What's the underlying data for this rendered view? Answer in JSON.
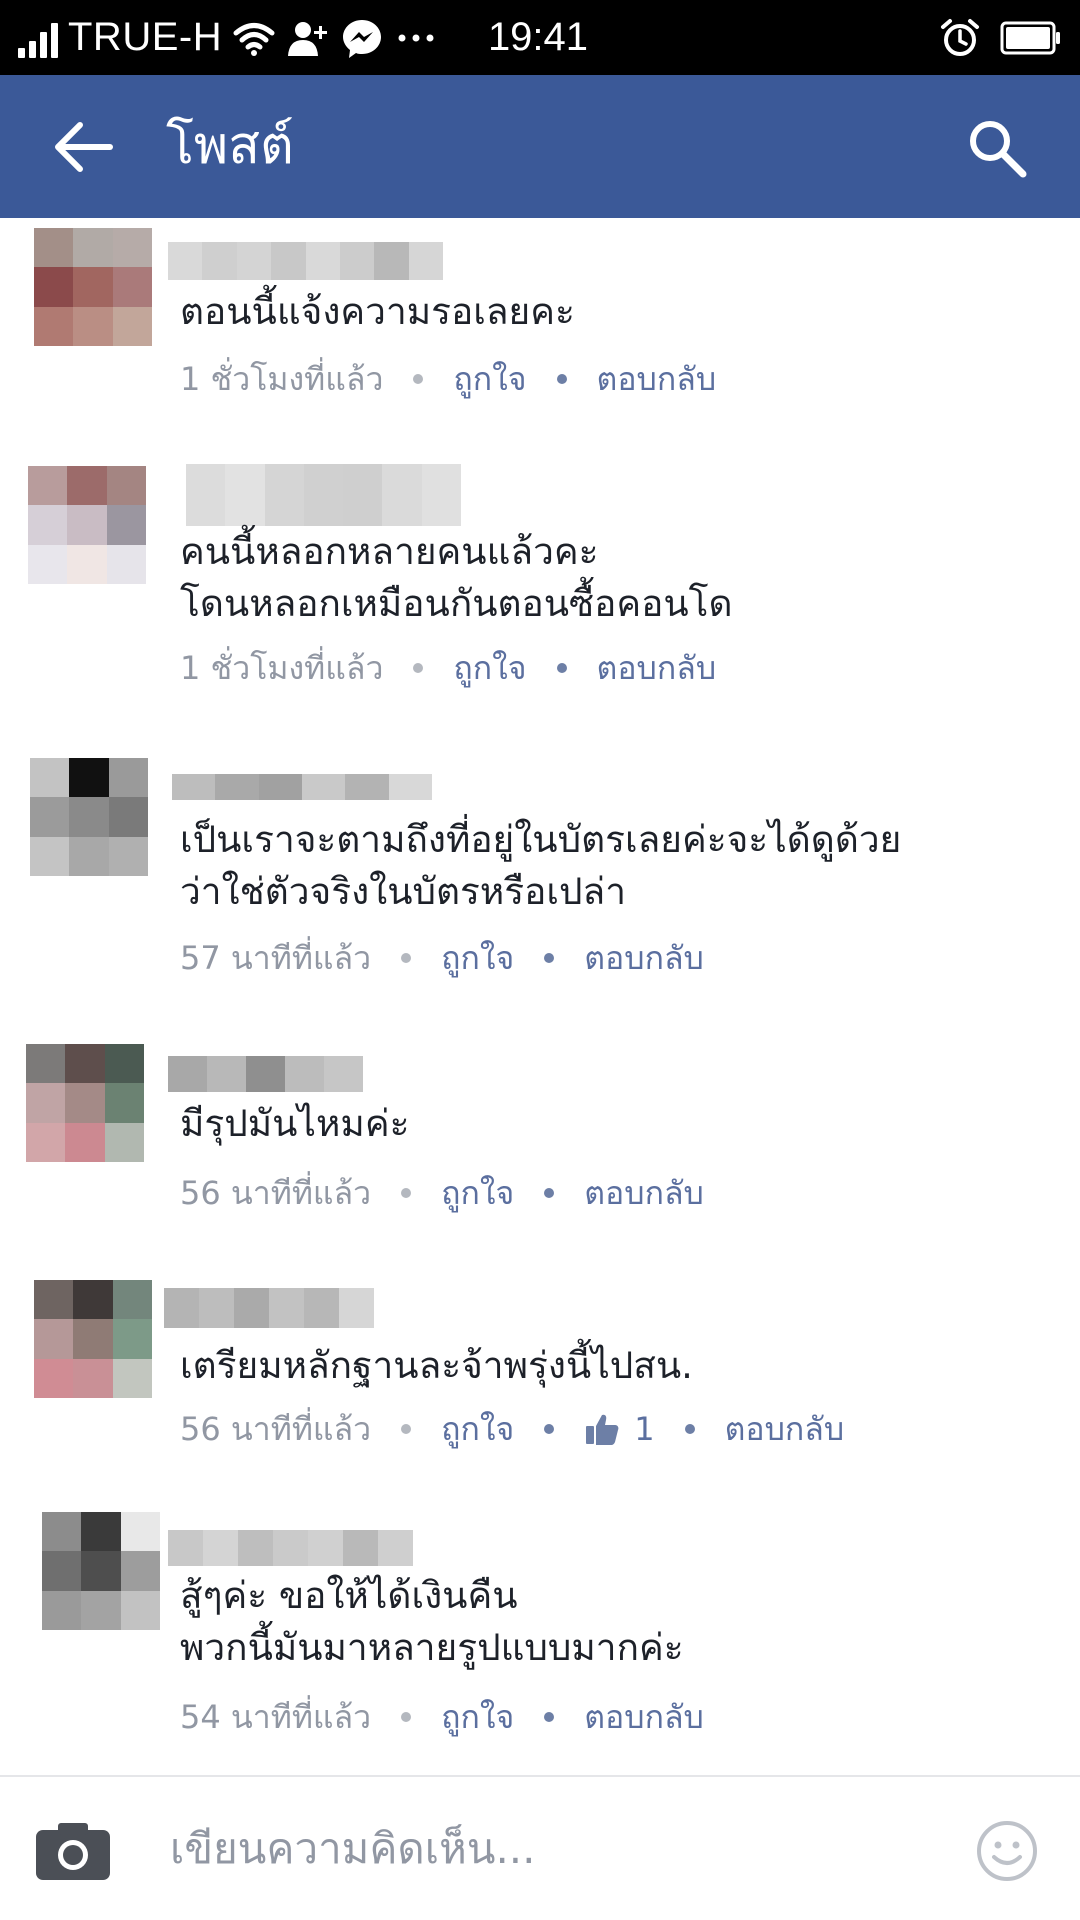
{
  "status_bar": {
    "carrier": "TRUE-H",
    "time": "19:41",
    "icons": [
      "signal-icon",
      "wifi-icon",
      "friend-request-icon",
      "messenger-icon",
      "more-icon",
      "alarm-icon",
      "battery-icon"
    ]
  },
  "app_bar": {
    "title": "โพสต์",
    "back_icon": "arrow-left-icon",
    "search_icon": "search-icon"
  },
  "comments": [
    {
      "text": "ตอนนี้แจ้งความรอเลยคะ",
      "time": "1 ชั่วโมงที่แล้ว",
      "like_label": "ถูกใจ",
      "reply_label": "ตอบกลับ",
      "avatar_colors": [
        "#a38f88",
        "#b1aaa6",
        "#b6aba8",
        "#8b4a4b",
        "#a16660",
        "#aa7a7a",
        "#b07a72",
        "#ba8e84",
        "#c2a69a"
      ],
      "name_colors": [
        "#d9d9d9",
        "#cfcfcf",
        "#d4d4d4",
        "#c8c8c8",
        "#d9d9d9",
        "#cccccc",
        "#b8b8b8",
        "#d6d6d6"
      ]
    },
    {
      "text": "คนนี้หลอกหลายคนแล้วคะ\nโดนหลอกเหมือนกันตอนซื้อคอนโด",
      "time": "1 ชั่วโมงที่แล้ว",
      "like_label": "ถูกใจ",
      "reply_label": "ตอบกลับ",
      "avatar_colors": [
        "#b89c9c",
        "#9c6b6a",
        "#a48582",
        "#d6cfd7",
        "#c9bcc4",
        "#9b96a0",
        "#e8e6ec",
        "#f0e6e4",
        "#e6e4ea"
      ],
      "name_colors": [
        "#dcdcdc",
        "#e2e2e2",
        "#d5d5d5",
        "#d0d0d0",
        "#cfcfcf",
        "#dadada",
        "#e0e0e0"
      ]
    },
    {
      "text": "เป็นเราจะตามถึงที่อยู่ในบัตรเลยค่ะจะได้ดูด้วย\nว่าใช่ตัวจริงในบัตรหรือเปล่า",
      "time": "57 นาทีที่แล้ว",
      "like_label": "ถูกใจ",
      "reply_label": "ตอบกลับ",
      "avatar_colors": [
        "#c3c3c3",
        "#111111",
        "#9a9a9a",
        "#9b9b9b",
        "#8a8a8a",
        "#7a7a7a",
        "#c4c4c4",
        "#a8a8a8",
        "#b0b0b0"
      ],
      "name_colors": [
        "#bdbdbd",
        "#a9a9a9",
        "#a1a1a1",
        "#c9c9c9",
        "#b3b3b3",
        "#d8d8d8"
      ]
    },
    {
      "text": "มีรุปมันไหมค่ะ",
      "time": "56 นาทีที่แล้ว",
      "like_label": "ถูกใจ",
      "reply_label": "ตอบกลับ",
      "avatar_colors": [
        "#7c7a79",
        "#5e4e4c",
        "#4b5a52",
        "#c0a4a5",
        "#a48a87",
        "#6b8272",
        "#d2a6a9",
        "#cc8991",
        "#b1b8b0"
      ],
      "name_colors": [
        "#a8a8a8",
        "#b8b8b8",
        "#8f8f8f",
        "#bcbcbc",
        "#c6c6c6"
      ]
    },
    {
      "text": "เตรียมหลักฐานละจ้าพรุ่งนี้ไปสน.",
      "time": "56 นาทีที่แล้ว",
      "like_label": "ถูกใจ",
      "like_count": "1",
      "reply_label": "ตอบกลับ",
      "avatar_colors": [
        "#6e6461",
        "#3f3938",
        "#73867c",
        "#b59898",
        "#8f7b75",
        "#7d9a88",
        "#d08c94",
        "#c99096",
        "#c2c6bf"
      ],
      "name_colors": [
        "#b4b4b4",
        "#bdbdbd",
        "#aaaaaa",
        "#c2c2c2",
        "#b7b7b7",
        "#d6d6d6"
      ]
    },
    {
      "text": "สู้ๆค่ะ ขอให้ได้เงินคืน\nพวกนี้มันมาหลายรูปแบบมากค่ะ",
      "time": "54 นาทีที่แล้ว",
      "like_label": "ถูกใจ",
      "reply_label": "ตอบกลับ",
      "avatar_colors": [
        "#8c8c8c",
        "#3a3a3a",
        "#e8e8e8",
        "#6f6f6f",
        "#4e4e4e",
        "#9d9d9d",
        "#9a9a9a",
        "#a3a3a3",
        "#c2c2c2"
      ],
      "name_colors": [
        "#c8c8c8",
        "#d4d4d4",
        "#bebebe",
        "#cacaca",
        "#d0d0d0",
        "#b9b9b9",
        "#cfcfcf"
      ]
    }
  ],
  "composer": {
    "placeholder": "เขียนความคิดเห็น...",
    "camera_icon": "camera-icon",
    "emoji_icon": "smiley-icon"
  },
  "colors": {
    "app_bar": "#3b5998",
    "link": "#5b6f9f",
    "timestamp": "#9197a3",
    "text": "#1d2129"
  }
}
